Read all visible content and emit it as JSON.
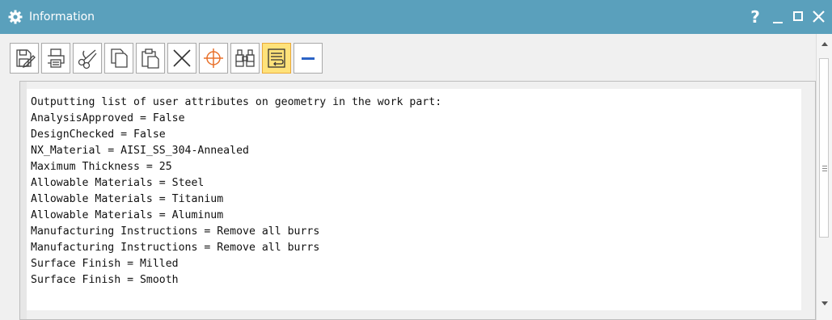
{
  "window": {
    "title": "Information",
    "help_label": "?"
  },
  "toolbar": {
    "buttons": [
      {
        "icon": "save-edit-icon"
      },
      {
        "icon": "print-icon"
      },
      {
        "icon": "cut-icon"
      },
      {
        "icon": "copy-icon"
      },
      {
        "icon": "paste-icon"
      },
      {
        "icon": "delete-icon"
      },
      {
        "icon": "target-icon"
      },
      {
        "icon": "find-icon"
      },
      {
        "icon": "word-wrap-icon",
        "active": true
      },
      {
        "icon": "minimize-panel-icon"
      }
    ]
  },
  "output": {
    "lines": [
      "Outputting list of user attributes on geometry in the work part:",
      "AnalysisApproved = False",
      "DesignChecked = False",
      "NX_Material = AISI_SS_304-Annealed",
      "Maximum Thickness = 25",
      "Allowable Materials = Steel",
      "Allowable Materials = Titanium",
      "Allowable Materials = Aluminum",
      "Manufacturing Instructions = Remove all burrs",
      "Manufacturing Instructions = Remove all burrs",
      "Surface Finish = Milled",
      "Surface Finish = Smooth"
    ]
  },
  "colors": {
    "titlebar": "#5aa0bc",
    "active_button": "#ffe27a",
    "target_accent": "#e8712b",
    "minimize_accent": "#2b63c6"
  }
}
